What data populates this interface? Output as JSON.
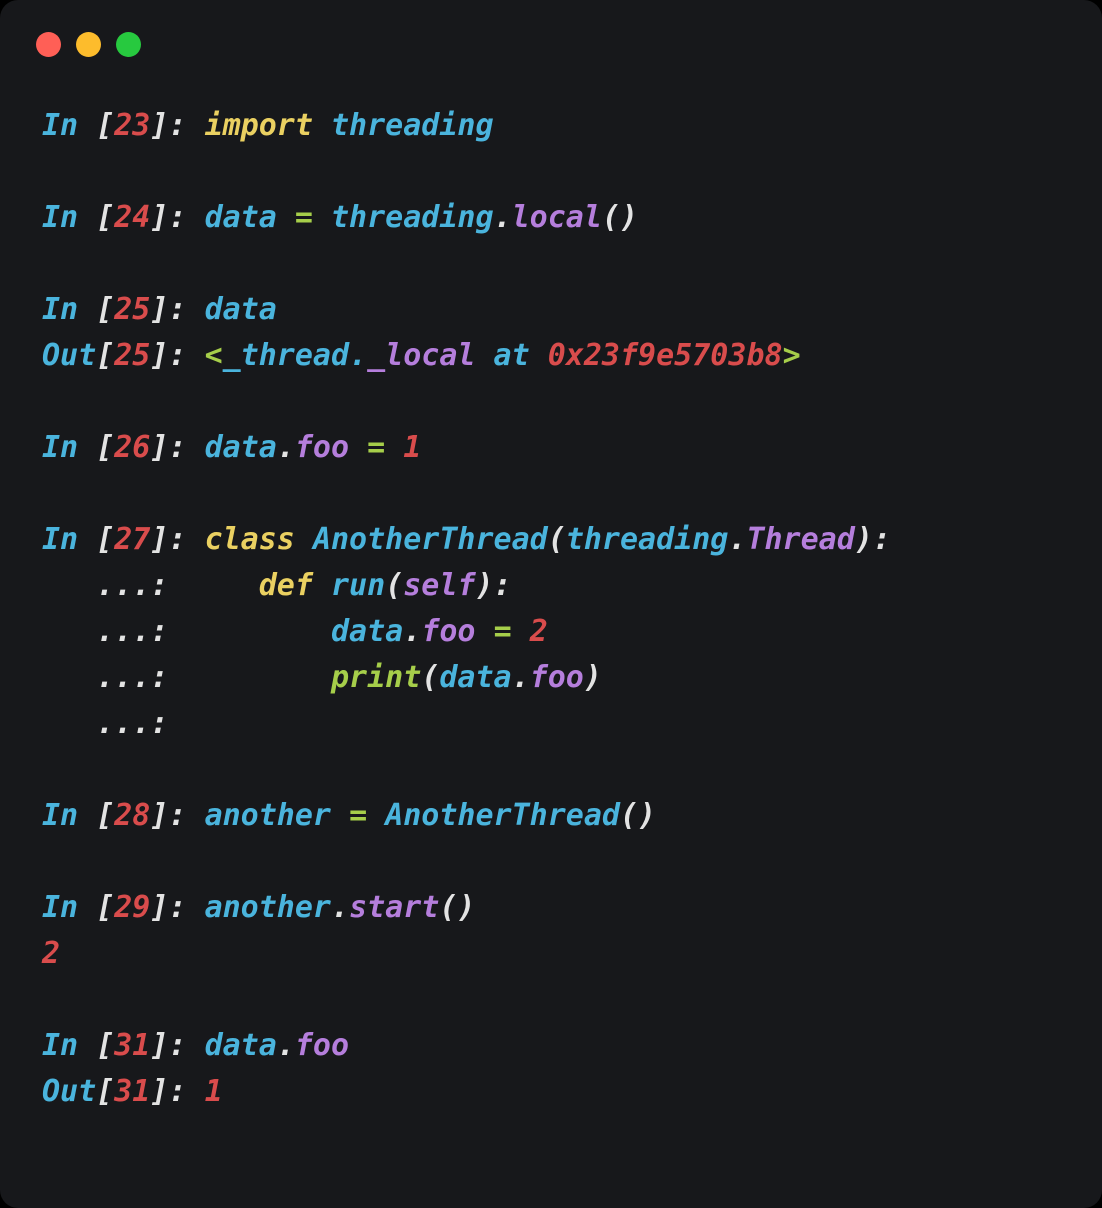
{
  "window": {
    "title": "IPython Session",
    "background": "#17181b",
    "outer_background": "#000000",
    "corner_radius_px": 18,
    "traffic_lights": [
      {
        "name": "close",
        "color": "#ff5f56"
      },
      {
        "name": "minimize",
        "color": "#fdbc2c"
      },
      {
        "name": "maximize",
        "color": "#27c93f"
      }
    ]
  },
  "palette": {
    "prompt_cyan": "#4ab4dd",
    "bracket_white": "#e3e3e3",
    "count_red": "#d94c4c",
    "keyword_yellow": "#ead061",
    "name_cyan": "#4ab4dd",
    "attribute_purple": "#b57edc",
    "operator_green": "#a6ce4a",
    "number_red": "#d94c4c",
    "builtin_green": "#a6ce4a",
    "punctuation_white": "#e3e3e3"
  },
  "session": {
    "lines": [
      {
        "id": "line-in-23",
        "kind": "input",
        "prompt": "In",
        "count": "23",
        "text": "In [23]: import threading",
        "tokens": [
          {
            "t": "In ",
            "c": "prompt"
          },
          {
            "t": "[",
            "c": "bracket"
          },
          {
            "t": "23",
            "c": "count"
          },
          {
            "t": "]",
            "c": "bracket"
          },
          {
            "t": ": ",
            "c": "bracket"
          },
          {
            "t": "import",
            "c": "kw"
          },
          {
            "t": " ",
            "c": "plain"
          },
          {
            "t": "threading",
            "c": "name"
          }
        ]
      },
      {
        "id": "blank-1",
        "kind": "blank",
        "text": "",
        "tokens": []
      },
      {
        "id": "line-in-24",
        "kind": "input",
        "prompt": "In",
        "count": "24",
        "text": "In [24]: data = threading.local()",
        "tokens": [
          {
            "t": "In ",
            "c": "prompt"
          },
          {
            "t": "[",
            "c": "bracket"
          },
          {
            "t": "24",
            "c": "count"
          },
          {
            "t": "]",
            "c": "bracket"
          },
          {
            "t": ": ",
            "c": "bracket"
          },
          {
            "t": "data",
            "c": "name"
          },
          {
            "t": " ",
            "c": "plain"
          },
          {
            "t": "=",
            "c": "op"
          },
          {
            "t": " ",
            "c": "plain"
          },
          {
            "t": "threading",
            "c": "name"
          },
          {
            "t": ".",
            "c": "punct"
          },
          {
            "t": "local",
            "c": "attr"
          },
          {
            "t": "()",
            "c": "punct"
          }
        ]
      },
      {
        "id": "blank-2",
        "kind": "blank",
        "text": "",
        "tokens": []
      },
      {
        "id": "line-in-25",
        "kind": "input",
        "prompt": "In",
        "count": "25",
        "text": "In [25]: data",
        "tokens": [
          {
            "t": "In ",
            "c": "prompt"
          },
          {
            "t": "[",
            "c": "bracket"
          },
          {
            "t": "25",
            "c": "count"
          },
          {
            "t": "]",
            "c": "bracket"
          },
          {
            "t": ": ",
            "c": "bracket"
          },
          {
            "t": "data",
            "c": "name"
          }
        ]
      },
      {
        "id": "line-out-25",
        "kind": "output",
        "prompt": "Out",
        "count": "25",
        "text": "Out[25]: <_thread._local at 0x23f9e5703b8>",
        "tokens": [
          {
            "t": "Out",
            "c": "prompt"
          },
          {
            "t": "[",
            "c": "bracket"
          },
          {
            "t": "25",
            "c": "count"
          },
          {
            "t": "]",
            "c": "bracket"
          },
          {
            "t": ": ",
            "c": "bracket"
          },
          {
            "t": "<",
            "c": "op"
          },
          {
            "t": "_thread.",
            "c": "name"
          },
          {
            "t": "_local",
            "c": "attr"
          },
          {
            "t": " at ",
            "c": "name"
          },
          {
            "t": "0x23f9e5703b8",
            "c": "num"
          },
          {
            "t": ">",
            "c": "op"
          }
        ]
      },
      {
        "id": "blank-3",
        "kind": "blank",
        "text": "",
        "tokens": []
      },
      {
        "id": "line-in-26",
        "kind": "input",
        "prompt": "In",
        "count": "26",
        "text": "In [26]: data.foo = 1",
        "tokens": [
          {
            "t": "In ",
            "c": "prompt"
          },
          {
            "t": "[",
            "c": "bracket"
          },
          {
            "t": "26",
            "c": "count"
          },
          {
            "t": "]",
            "c": "bracket"
          },
          {
            "t": ": ",
            "c": "bracket"
          },
          {
            "t": "data",
            "c": "name"
          },
          {
            "t": ".",
            "c": "punct"
          },
          {
            "t": "foo",
            "c": "attr"
          },
          {
            "t": " ",
            "c": "plain"
          },
          {
            "t": "=",
            "c": "op"
          },
          {
            "t": " ",
            "c": "plain"
          },
          {
            "t": "1",
            "c": "num"
          }
        ]
      },
      {
        "id": "blank-4",
        "kind": "blank",
        "text": "",
        "tokens": []
      },
      {
        "id": "line-in-27",
        "kind": "input",
        "prompt": "In",
        "count": "27",
        "text": "In [27]: class AnotherThread(threading.Thread):",
        "tokens": [
          {
            "t": "In ",
            "c": "prompt"
          },
          {
            "t": "[",
            "c": "bracket"
          },
          {
            "t": "27",
            "c": "count"
          },
          {
            "t": "]",
            "c": "bracket"
          },
          {
            "t": ": ",
            "c": "bracket"
          },
          {
            "t": "class",
            "c": "kw"
          },
          {
            "t": " ",
            "c": "plain"
          },
          {
            "t": "AnotherThread",
            "c": "name"
          },
          {
            "t": "(",
            "c": "punct"
          },
          {
            "t": "threading",
            "c": "name"
          },
          {
            "t": ".",
            "c": "punct"
          },
          {
            "t": "Thread",
            "c": "attr"
          },
          {
            "t": "):",
            "c": "punct"
          }
        ]
      },
      {
        "id": "line-cont-27-a",
        "kind": "continuation",
        "prompt": "...:",
        "count": "",
        "text": "   ...:     def run(self):",
        "tokens": [
          {
            "t": "   ...: ",
            "c": "cont"
          },
          {
            "t": "    ",
            "c": "plain"
          },
          {
            "t": "def",
            "c": "kw"
          },
          {
            "t": " ",
            "c": "plain"
          },
          {
            "t": "run",
            "c": "name"
          },
          {
            "t": "(",
            "c": "punct"
          },
          {
            "t": "self",
            "c": "attr"
          },
          {
            "t": "):",
            "c": "punct"
          }
        ]
      },
      {
        "id": "line-cont-27-b",
        "kind": "continuation",
        "prompt": "...:",
        "count": "",
        "text": "   ...:         data.foo = 2",
        "tokens": [
          {
            "t": "   ...: ",
            "c": "cont"
          },
          {
            "t": "        ",
            "c": "plain"
          },
          {
            "t": "data",
            "c": "name"
          },
          {
            "t": ".",
            "c": "punct"
          },
          {
            "t": "foo",
            "c": "attr"
          },
          {
            "t": " ",
            "c": "plain"
          },
          {
            "t": "=",
            "c": "op"
          },
          {
            "t": " ",
            "c": "plain"
          },
          {
            "t": "2",
            "c": "num"
          }
        ]
      },
      {
        "id": "line-cont-27-c",
        "kind": "continuation",
        "prompt": "...:",
        "count": "",
        "text": "   ...:         print(data.foo)",
        "tokens": [
          {
            "t": "   ...: ",
            "c": "cont"
          },
          {
            "t": "        ",
            "c": "plain"
          },
          {
            "t": "print",
            "c": "builtin"
          },
          {
            "t": "(",
            "c": "punct"
          },
          {
            "t": "data",
            "c": "name"
          },
          {
            "t": ".",
            "c": "punct"
          },
          {
            "t": "foo",
            "c": "attr"
          },
          {
            "t": ")",
            "c": "punct"
          }
        ]
      },
      {
        "id": "line-cont-27-d",
        "kind": "continuation",
        "prompt": "...:",
        "count": "",
        "text": "   ...:",
        "tokens": [
          {
            "t": "   ...:",
            "c": "cont"
          }
        ]
      },
      {
        "id": "blank-5",
        "kind": "blank",
        "text": "",
        "tokens": []
      },
      {
        "id": "line-in-28",
        "kind": "input",
        "prompt": "In",
        "count": "28",
        "text": "In [28]: another = AnotherThread()",
        "tokens": [
          {
            "t": "In ",
            "c": "prompt"
          },
          {
            "t": "[",
            "c": "bracket"
          },
          {
            "t": "28",
            "c": "count"
          },
          {
            "t": "]",
            "c": "bracket"
          },
          {
            "t": ": ",
            "c": "bracket"
          },
          {
            "t": "another",
            "c": "name"
          },
          {
            "t": " ",
            "c": "plain"
          },
          {
            "t": "=",
            "c": "op"
          },
          {
            "t": " ",
            "c": "plain"
          },
          {
            "t": "AnotherThread",
            "c": "name"
          },
          {
            "t": "()",
            "c": "punct"
          }
        ]
      },
      {
        "id": "blank-6",
        "kind": "blank",
        "text": "",
        "tokens": []
      },
      {
        "id": "line-in-29",
        "kind": "input",
        "prompt": "In",
        "count": "29",
        "text": "In [29]: another.start()",
        "tokens": [
          {
            "t": "In ",
            "c": "prompt"
          },
          {
            "t": "[",
            "c": "bracket"
          },
          {
            "t": "29",
            "c": "count"
          },
          {
            "t": "]",
            "c": "bracket"
          },
          {
            "t": ": ",
            "c": "bracket"
          },
          {
            "t": "another",
            "c": "name"
          },
          {
            "t": ".",
            "c": "punct"
          },
          {
            "t": "start",
            "c": "attr"
          },
          {
            "t": "()",
            "c": "punct"
          }
        ]
      },
      {
        "id": "line-stdout-29",
        "kind": "stdout",
        "prompt": "",
        "count": "",
        "text": "2",
        "tokens": [
          {
            "t": "2",
            "c": "num"
          }
        ]
      },
      {
        "id": "blank-7",
        "kind": "blank",
        "text": "",
        "tokens": []
      },
      {
        "id": "line-in-31",
        "kind": "input",
        "prompt": "In",
        "count": "31",
        "text": "In [31]: data.foo",
        "tokens": [
          {
            "t": "In ",
            "c": "prompt"
          },
          {
            "t": "[",
            "c": "bracket"
          },
          {
            "t": "31",
            "c": "count"
          },
          {
            "t": "]",
            "c": "bracket"
          },
          {
            "t": ": ",
            "c": "bracket"
          },
          {
            "t": "data",
            "c": "name"
          },
          {
            "t": ".",
            "c": "punct"
          },
          {
            "t": "foo",
            "c": "attr"
          }
        ]
      },
      {
        "id": "line-out-31",
        "kind": "output",
        "prompt": "Out",
        "count": "31",
        "text": "Out[31]: 1",
        "tokens": [
          {
            "t": "Out",
            "c": "prompt"
          },
          {
            "t": "[",
            "c": "bracket"
          },
          {
            "t": "31",
            "c": "count"
          },
          {
            "t": "]",
            "c": "bracket"
          },
          {
            "t": ": ",
            "c": "bracket"
          },
          {
            "t": "1",
            "c": "num"
          }
        ]
      }
    ]
  }
}
